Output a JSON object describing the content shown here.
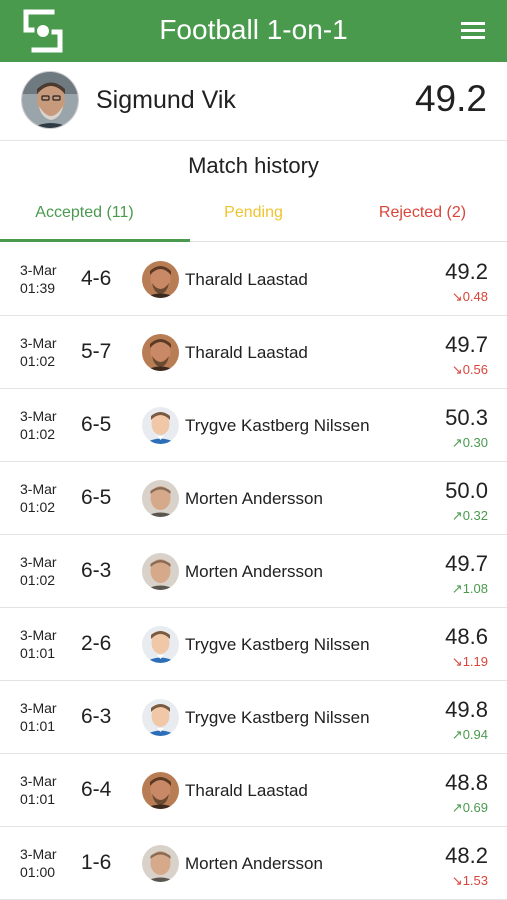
{
  "app": {
    "title": "Football 1-on-1"
  },
  "colors": {
    "brand": "#4a9a4e",
    "pending": "#f0c330",
    "rejected": "#d9453b"
  },
  "icons": {
    "logo": "app-logo-icon",
    "menu": "hamburger-menu-icon"
  },
  "profile": {
    "name": "Sigmund Vik",
    "rating": "49.2"
  },
  "section": {
    "title": "Match history"
  },
  "tabs": [
    {
      "label": "Accepted (11)",
      "selected": true
    },
    {
      "label": "Pending",
      "selected": false
    },
    {
      "label": "Rejected (2)",
      "selected": false
    }
  ],
  "matches": [
    {
      "date": "3-Mar",
      "time": "01:39",
      "score": "4-6",
      "opponent": "Tharald Laastad",
      "rating": "49.2",
      "delta": "↘0.48",
      "trend": "down"
    },
    {
      "date": "3-Mar",
      "time": "01:02",
      "score": "5-7",
      "opponent": "Tharald Laastad",
      "rating": "49.7",
      "delta": "↘0.56",
      "trend": "down"
    },
    {
      "date": "3-Mar",
      "time": "01:02",
      "score": "6-5",
      "opponent": "Trygve Kastberg Nilssen",
      "rating": "50.3",
      "delta": "↗0.30",
      "trend": "up"
    },
    {
      "date": "3-Mar",
      "time": "01:02",
      "score": "6-5",
      "opponent": "Morten Andersson",
      "rating": "50.0",
      "delta": "↗0.32",
      "trend": "up"
    },
    {
      "date": "3-Mar",
      "time": "01:02",
      "score": "6-3",
      "opponent": "Morten Andersson",
      "rating": "49.7",
      "delta": "↗1.08",
      "trend": "up"
    },
    {
      "date": "3-Mar",
      "time": "01:01",
      "score": "2-6",
      "opponent": "Trygve Kastberg Nilssen",
      "rating": "48.6",
      "delta": "↘1.19",
      "trend": "down"
    },
    {
      "date": "3-Mar",
      "time": "01:01",
      "score": "6-3",
      "opponent": "Trygve Kastberg Nilssen",
      "rating": "49.8",
      "delta": "↗0.94",
      "trend": "up"
    },
    {
      "date": "3-Mar",
      "time": "01:01",
      "score": "6-4",
      "opponent": "Tharald Laastad",
      "rating": "48.8",
      "delta": "↗0.69",
      "trend": "up"
    },
    {
      "date": "3-Mar",
      "time": "01:00",
      "score": "1-6",
      "opponent": "Morten Andersson",
      "rating": "48.2",
      "delta": "↘1.53",
      "trend": "down"
    }
  ]
}
